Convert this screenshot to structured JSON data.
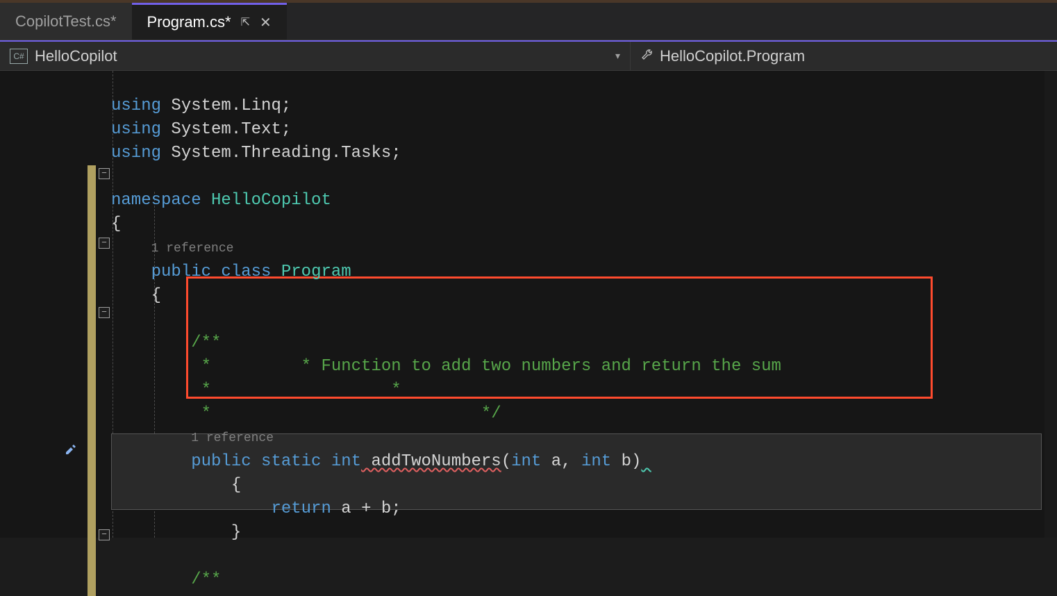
{
  "tabs": {
    "inactive": "CopilotTest.cs*",
    "active": "Program.cs*"
  },
  "nav": {
    "fileicon_text": "C#",
    "left": "HelloCopilot",
    "right": "HelloCopilot.Program"
  },
  "code": {
    "using1_kw": "using",
    "using1_ns": " System.Linq;",
    "using2_kw": "using",
    "using2_ns": " System.Text;",
    "using3_kw": "using",
    "using3_ns": " System.Threading.Tasks;",
    "ns_kw": "namespace",
    "ns_name": " HelloCopilot",
    "brace_open": "{",
    "codelens1": "1 reference",
    "public_kw": "public",
    "class_kw": " class",
    "class_name": " Program",
    "brace_open2": "    {",
    "comment1": "        /**",
    "comment2": "         *         * Function to add two numbers and return the sum",
    "comment3": "         *                  *",
    "comment4": "         *                           */",
    "codelens2": "1 reference",
    "public_kw2": "public",
    "static_kw": " static",
    "int_kw": " int",
    "method_name": " addTwoNumbers",
    "paren_open": "(",
    "int_kw2": "int",
    "param_a": " a",
    "comma": ",",
    "int_kw3": " int",
    "param_b": " b",
    "paren_close": ")",
    "brace_open3": "            {",
    "return_kw": "return",
    "return_expr": " a + b;",
    "brace_close3": "            }",
    "comment5": "        /**"
  },
  "fold_glyph": "−"
}
